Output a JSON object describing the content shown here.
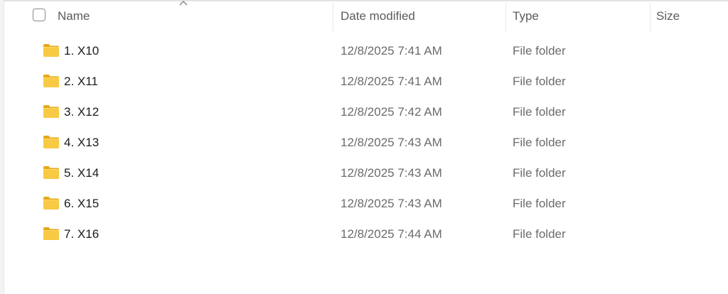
{
  "columns": {
    "name": "Name",
    "date_modified": "Date modified",
    "type": "Type",
    "size": "Size"
  },
  "sort": {
    "column": "name",
    "direction": "ascending"
  },
  "colors": {
    "folder_body": "#f8c943",
    "folder_tab": "#e6a817",
    "header_text": "#5b5b5b",
    "name_text": "#1b1b1b",
    "meta_text": "#6b6b6b"
  },
  "items": [
    {
      "name": "1. X10",
      "date": "12/8/2025 7:41 AM",
      "type": "File folder",
      "size": "",
      "icon": "folder-icon"
    },
    {
      "name": "2. X11",
      "date": "12/8/2025 7:41 AM",
      "type": "File folder",
      "size": "",
      "icon": "folder-icon"
    },
    {
      "name": "3. X12",
      "date": "12/8/2025 7:42 AM",
      "type": "File folder",
      "size": "",
      "icon": "folder-icon"
    },
    {
      "name": "4. X13",
      "date": "12/8/2025 7:43 AM",
      "type": "File folder",
      "size": "",
      "icon": "folder-icon"
    },
    {
      "name": "5. X14",
      "date": "12/8/2025 7:43 AM",
      "type": "File folder",
      "size": "",
      "icon": "folder-icon"
    },
    {
      "name": "6. X15",
      "date": "12/8/2025 7:43 AM",
      "type": "File folder",
      "size": "",
      "icon": "folder-icon"
    },
    {
      "name": "7. X16",
      "date": "12/8/2025 7:44 AM",
      "type": "File folder",
      "size": "",
      "icon": "folder-icon"
    }
  ]
}
